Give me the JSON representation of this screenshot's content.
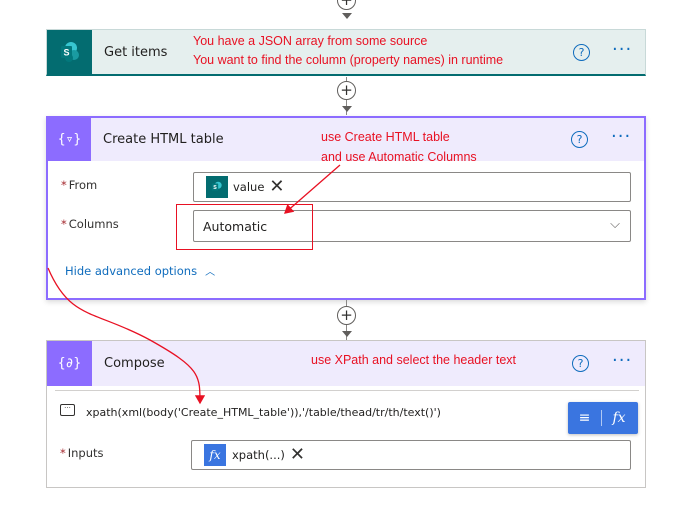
{
  "steps": {
    "get_items": {
      "title": "Get items",
      "icon": "sharepoint-icon",
      "color": "#036c70"
    },
    "create_html_table": {
      "title": "Create HTML table",
      "icon": "data-operation-icon",
      "from_label": "From",
      "from_token": "value",
      "columns_label": "Columns",
      "columns_value": "Automatic",
      "advanced_link": "Hide advanced options",
      "color": "#8c6cff"
    },
    "compose": {
      "title": "Compose",
      "icon": "data-operation-icon",
      "expression": "xpath(xml(body('Create_HTML_table')),'/table/thead/tr/th/text()')",
      "inputs_label": "Inputs",
      "inputs_token": "xpath(...)",
      "fx_label": "fx",
      "color": "#8c6cff"
    }
  },
  "annotations": {
    "get_items_line1": "You have a JSON array from some source",
    "get_items_line2": "You want to find the column (property names) in runtime",
    "create_line1": "use Create HTML table",
    "create_line2": "and use Automatic Columns",
    "compose_line": "use XPath and select the header text"
  },
  "colors": {
    "annotation": "#e81123",
    "accent": "#0f6cbd",
    "selected_border": "#8c6cff"
  }
}
